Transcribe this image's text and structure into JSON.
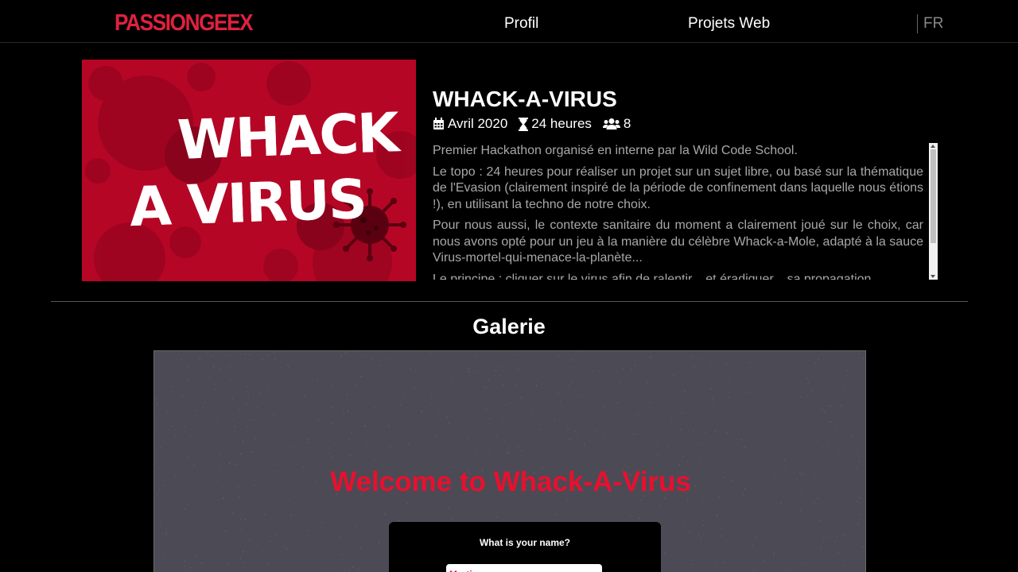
{
  "header": {
    "logo": "PASSIONGEEX",
    "nav": [
      {
        "label": "Profil"
      },
      {
        "label": "Projets Web"
      }
    ],
    "language": "FR"
  },
  "project": {
    "image_text_line1": "WHACK",
    "image_text_line2": "A VIRUS",
    "title": "WHACK-A-VIRUS",
    "date": "Avril 2020",
    "duration": "24 heures",
    "team_size": "8",
    "icons": [
      "calendar-icon",
      "hourglass-icon",
      "users-icon"
    ],
    "description": [
      "Premier Hackathon organisé en interne par la Wild Code School.",
      "Le topo : 24 heures pour réaliser un projet sur un sujet libre, ou basé sur la thématique de l'Evasion (clairement inspiré de la période de confinement dans laquelle nous étions !), en utilisant la techno de notre choix.",
      "Pour nous aussi, le contexte sanitaire du moment a clairement joué sur le choix, car nous avons opté pour un jeu à la manière du célèbre Whack-a-Mole, adapté à la sauce Virus-mortel-qui-menace-la-planète...",
      "Le principe : cliquer sur le virus afin de ralentir... et éradiquer... sa propagation."
    ]
  },
  "gallery": {
    "title": "Galerie",
    "screenshot": {
      "welcome": "Welcome to Whack-A-Virus",
      "name_prompt": "What is your name?",
      "name_value": "Martin"
    }
  },
  "colors": {
    "brand_red": "#e0213f",
    "image_red": "#b60626",
    "background": "#000000",
    "text_muted": "#a8a8a8"
  }
}
